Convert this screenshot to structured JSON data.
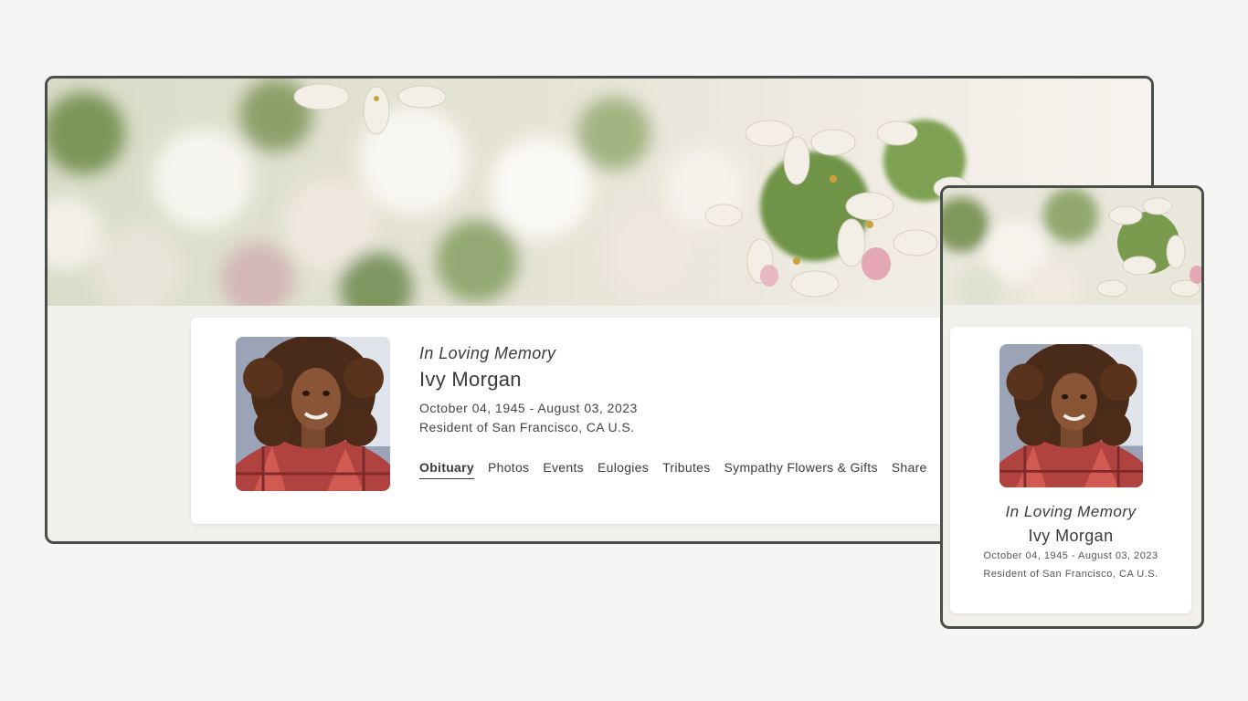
{
  "profile": {
    "memory_heading": "In Loving Memory",
    "name": "Ivy Morgan",
    "dates": "October 04, 1945 - August 03, 2023",
    "residence": "Resident of San Francisco, CA U.S."
  },
  "nav": {
    "items": [
      {
        "label": "Obituary",
        "active": true
      },
      {
        "label": "Photos"
      },
      {
        "label": "Events"
      },
      {
        "label": "Eulogies"
      },
      {
        "label": "Tributes"
      },
      {
        "label": "Sympathy Flowers & Gifts"
      },
      {
        "label": "Share"
      }
    ]
  },
  "mobile": {
    "memory_heading": "In Loving Memory",
    "name": "Ivy Morgan",
    "dates": "October 04, 1945 - August 03, 2023",
    "residence": "Resident of San Francisco, CA U.S."
  },
  "colors": {
    "page_bg": "#f5f5f4",
    "frame_border": "#4a4e48",
    "content_bg": "#f1f0ec",
    "card_bg": "#ffffff",
    "text": "#3a3a3a"
  },
  "images": {
    "banner": "blossom-banner-image",
    "portrait": "portrait-photo"
  }
}
